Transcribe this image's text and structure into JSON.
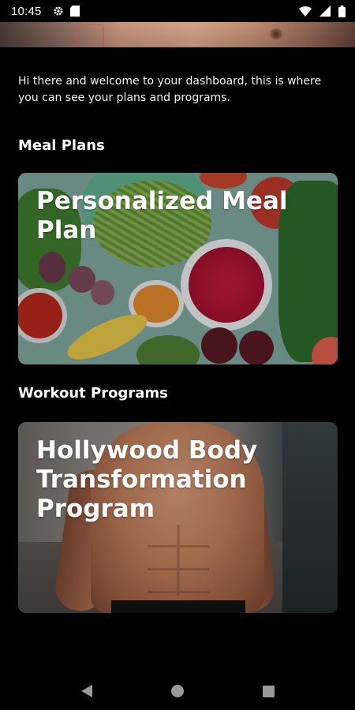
{
  "status_bar": {
    "time": "10:45",
    "left_icons": [
      "gear-icon",
      "sd-card-icon"
    ],
    "right_icons": [
      "wifi-icon",
      "signal-icon",
      "battery-icon"
    ]
  },
  "welcome_text": "Hi there and welcome to your dashboard, this is where you can see your plans and programs.",
  "meal_section": {
    "title": "Meal Plans",
    "card": {
      "title": "Personalized Meal Plan"
    }
  },
  "workout_section": {
    "title": "Workout Programs",
    "card": {
      "title": "Hollywood Body Transformation Program"
    }
  },
  "nav_bar": {
    "icons": [
      "back-icon",
      "home-icon",
      "recents-icon"
    ]
  }
}
